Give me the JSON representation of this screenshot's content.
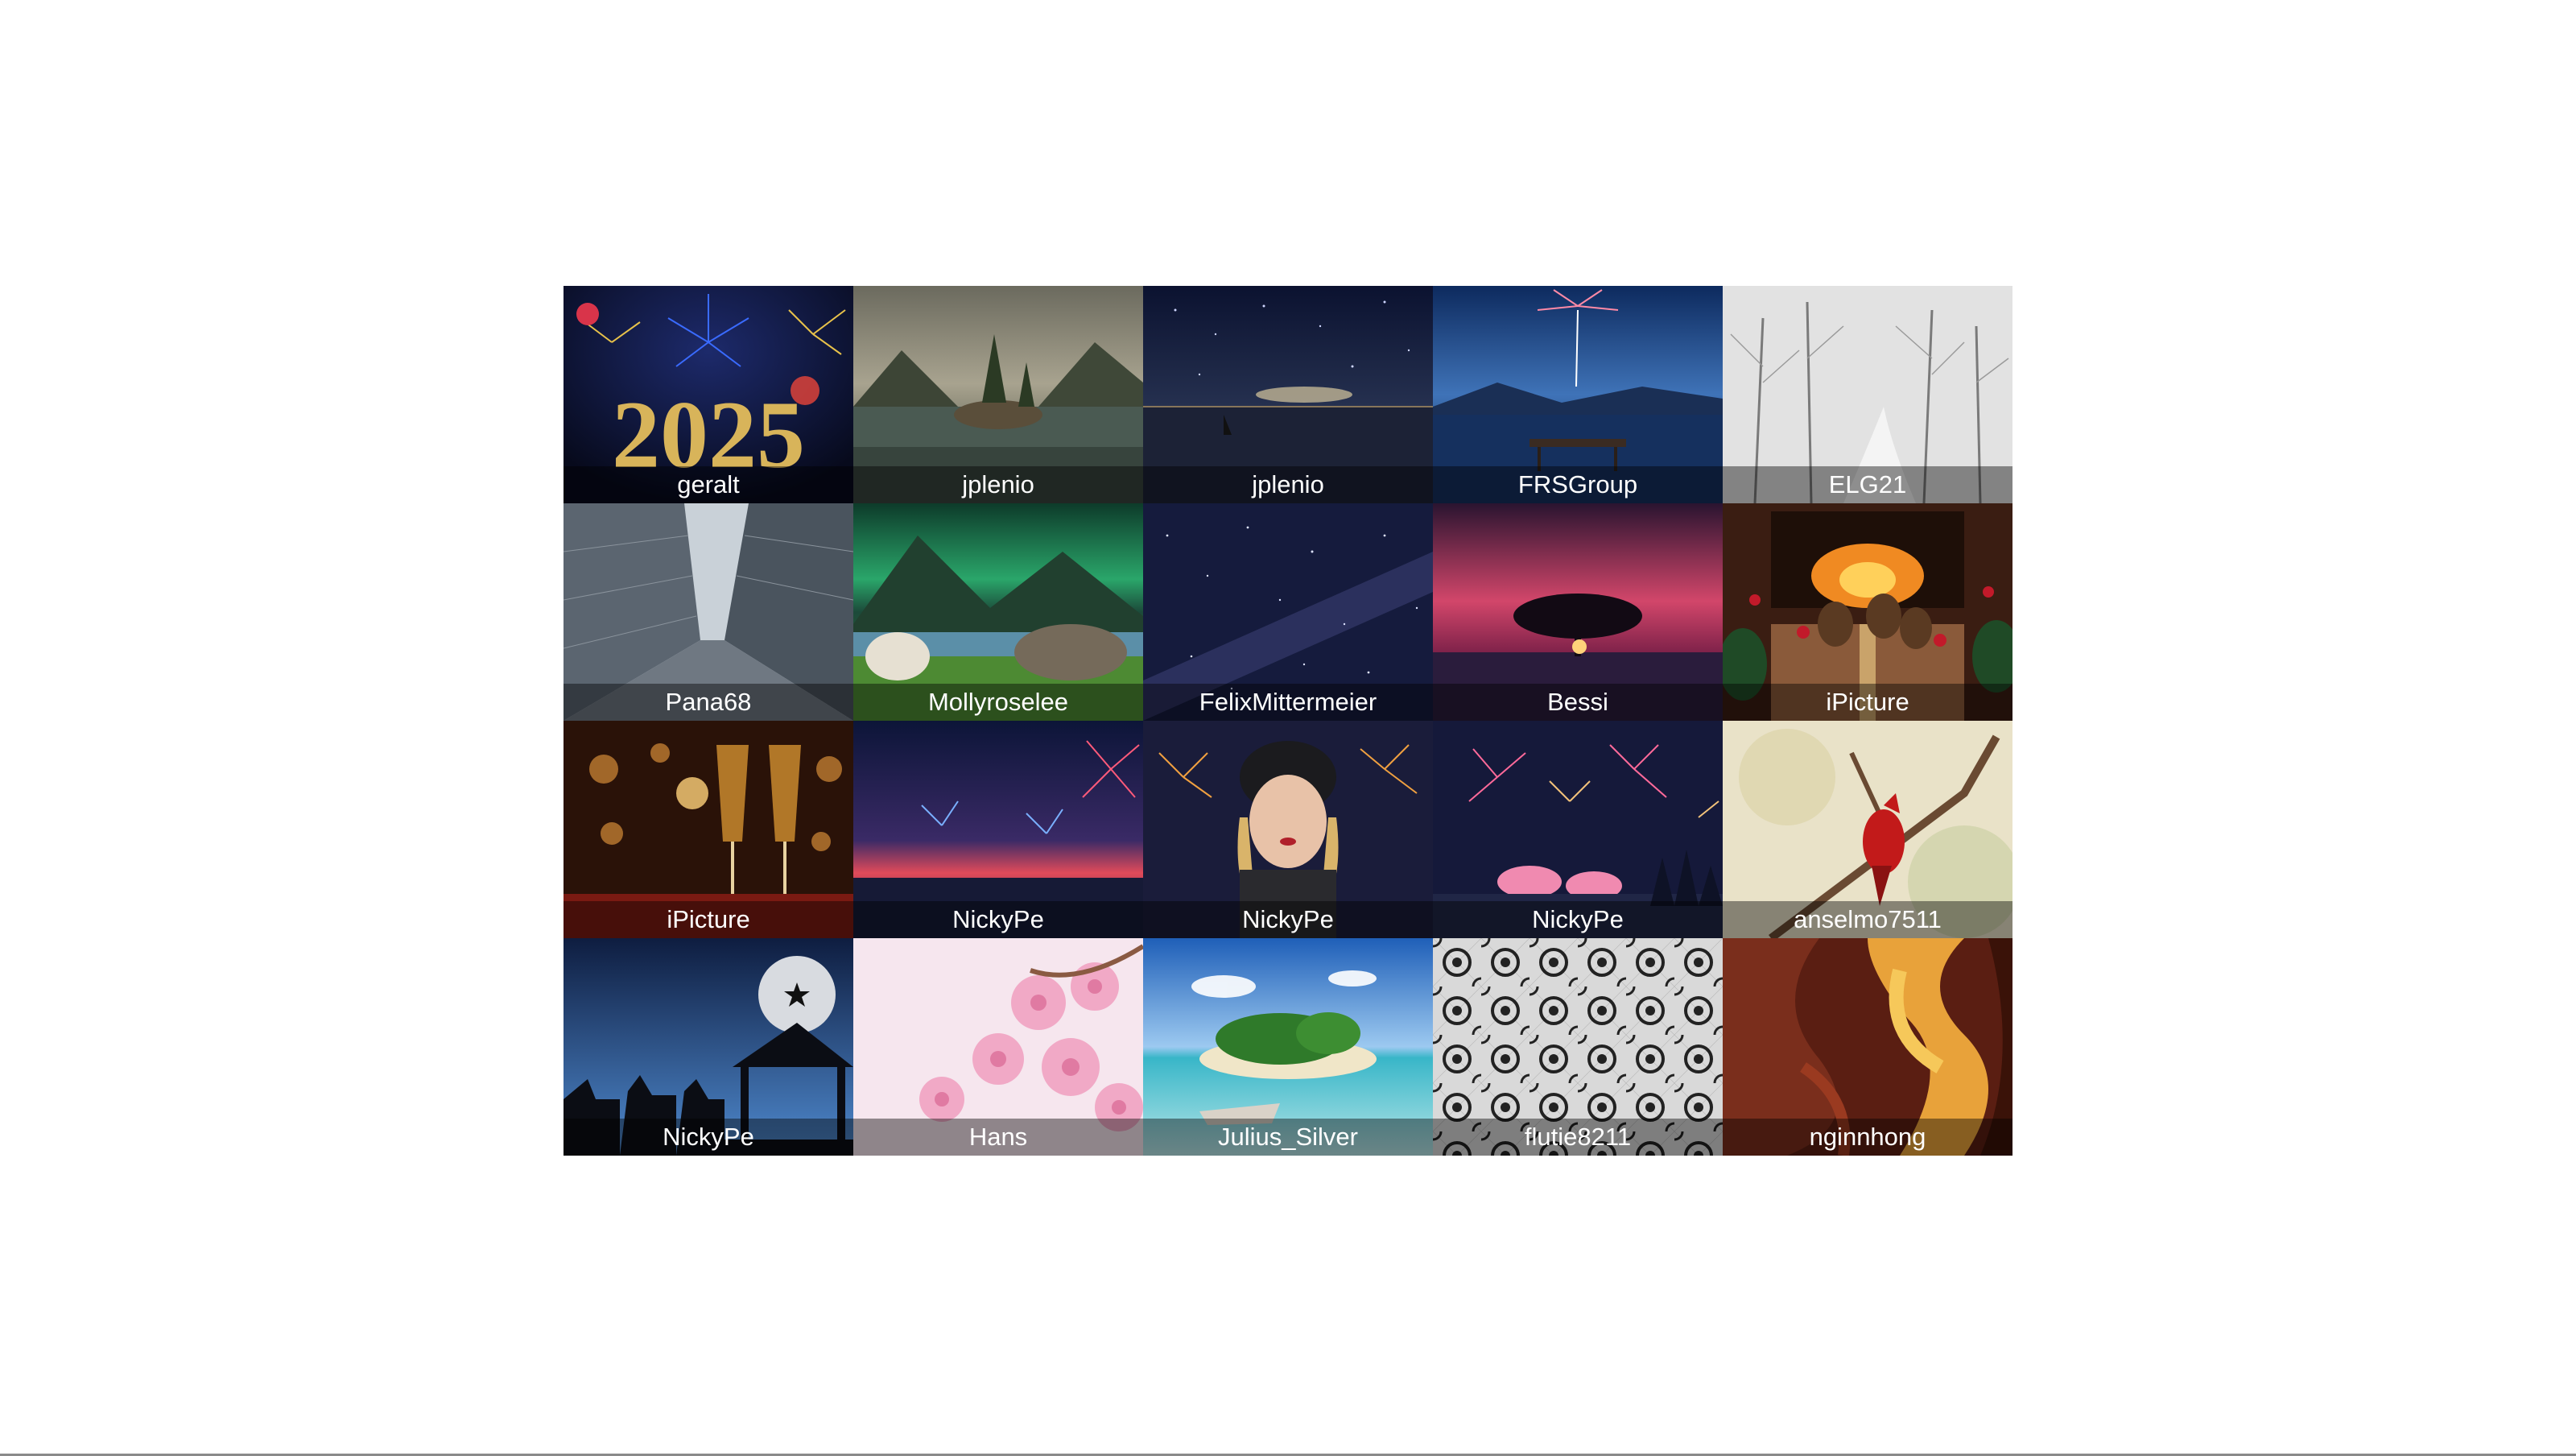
{
  "gallery": {
    "tiles": [
      {
        "author": "geralt",
        "scene": "new-year-2025-fireworks"
      },
      {
        "author": "jplenio",
        "scene": "mountain-lake-island-trees"
      },
      {
        "author": "jplenio",
        "scene": "night-sky-sailboat"
      },
      {
        "author": "FRSGroup",
        "scene": "lake-pier-firework"
      },
      {
        "author": "ELG21",
        "scene": "snowy-forest-path"
      },
      {
        "author": "Pana68",
        "scene": "skyscrapers-looking-up"
      },
      {
        "author": "Mollyroselee",
        "scene": "aurora-valley-bear"
      },
      {
        "author": "FelixMittermeier",
        "scene": "milky-way-starfield"
      },
      {
        "author": "Bessi",
        "scene": "tree-silhouette-red-sky"
      },
      {
        "author": "iPicture",
        "scene": "fireplace-pinecones-gift"
      },
      {
        "author": "iPicture",
        "scene": "champagne-glasses-bokeh"
      },
      {
        "author": "NickyPe",
        "scene": "fireworks-over-lake"
      },
      {
        "author": "NickyPe",
        "scene": "woman-beanie-fireworks"
      },
      {
        "author": "NickyPe",
        "scene": "pink-fireworks-winter"
      },
      {
        "author": "anselmo7511",
        "scene": "red-cardinal-branch"
      },
      {
        "author": "NickyPe",
        "scene": "nativity-camels-moon"
      },
      {
        "author": "Hans",
        "scene": "pink-cherry-blossoms"
      },
      {
        "author": "Julius_Silver",
        "scene": "tropical-island-boat"
      },
      {
        "author": "flutie8211",
        "scene": "black-lace-pattern"
      },
      {
        "author": "nginnhong",
        "scene": "antelope-canyon-waves"
      }
    ]
  }
}
